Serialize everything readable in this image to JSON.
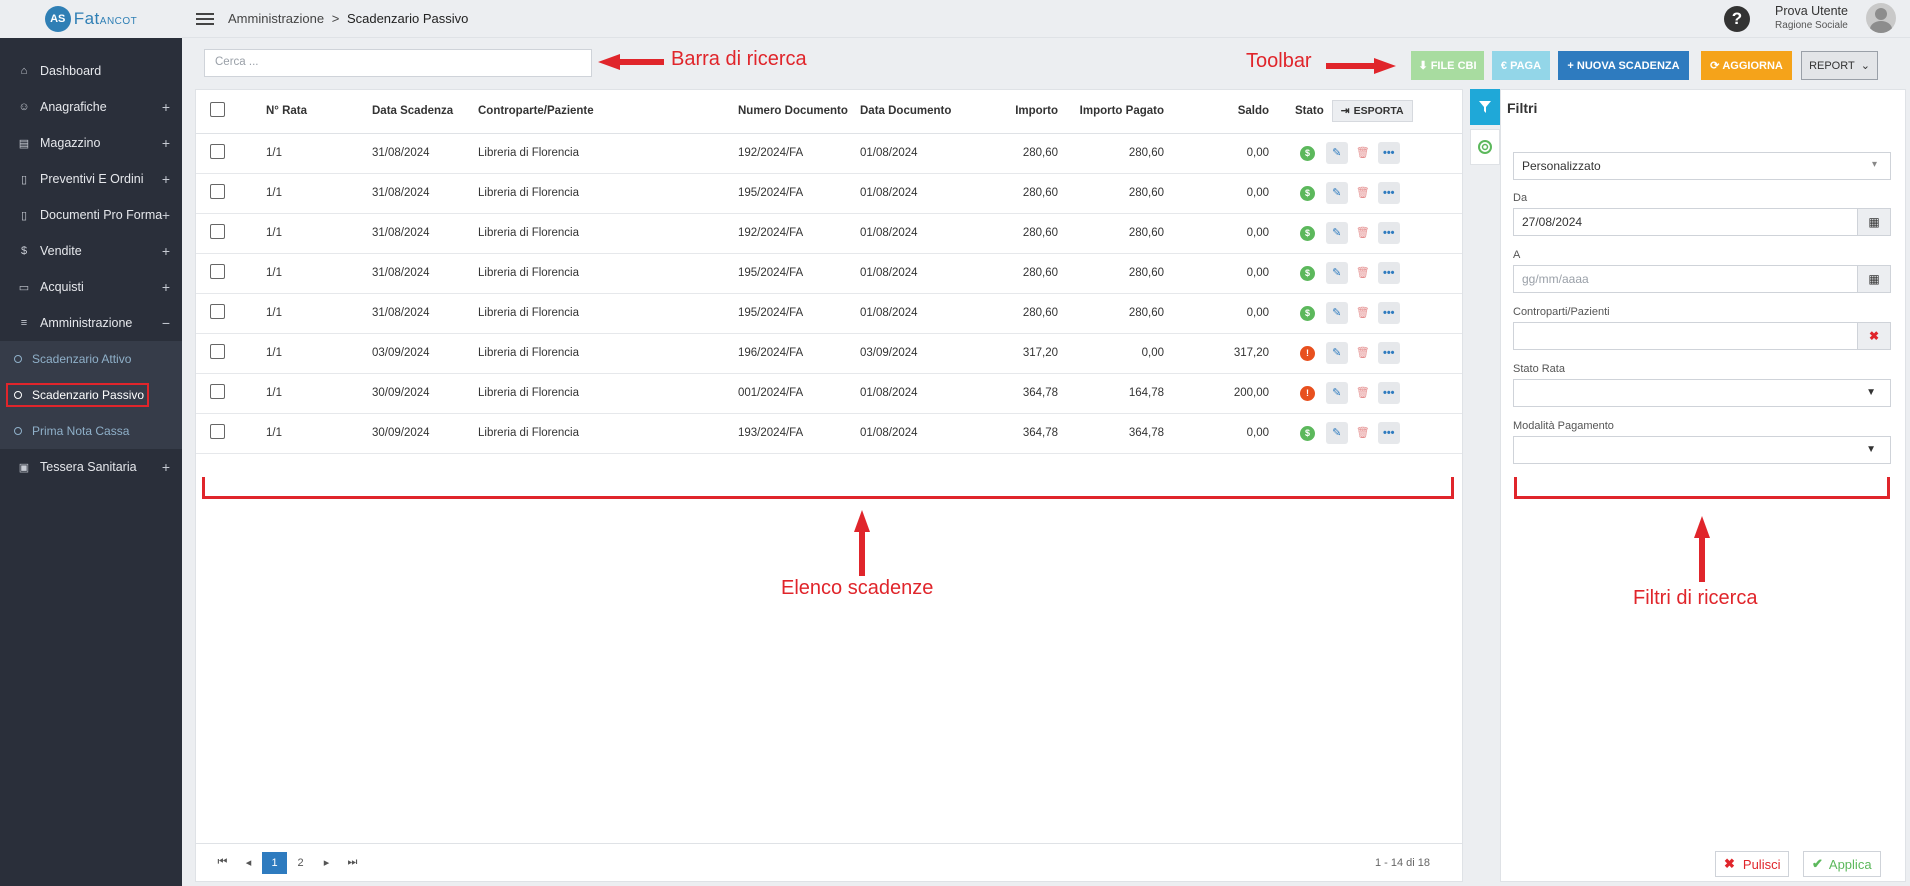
{
  "app": {
    "logo_badge": "AS",
    "logo_name": "Fat",
    "logo_suffix": "ANCOT"
  },
  "sidebar": {
    "items": [
      {
        "label": "Dashboard",
        "icon": "home-icon",
        "expandable": false
      },
      {
        "label": "Anagrafiche",
        "icon": "user-icon",
        "expandable": true
      },
      {
        "label": "Magazzino",
        "icon": "warehouse-icon",
        "expandable": true
      },
      {
        "label": "Preventivi E Ordini",
        "icon": "document-icon",
        "expandable": true
      },
      {
        "label": "Documenti Pro Forma",
        "icon": "document-icon",
        "expandable": true
      },
      {
        "label": "Vendite",
        "icon": "dollar-icon",
        "expandable": true
      },
      {
        "label": "Acquisti",
        "icon": "card-icon",
        "expandable": true
      },
      {
        "label": "Amministrazione",
        "icon": "database-icon",
        "expandable": true,
        "open": true
      },
      {
        "label": "Tessera Sanitaria",
        "icon": "id-card-icon",
        "expandable": true
      }
    ],
    "sub_items": [
      {
        "label": "Scadenzario Attivo",
        "active": false
      },
      {
        "label": "Scadenzario Passivo",
        "active": true
      },
      {
        "label": "Prima Nota Cassa",
        "active": false
      }
    ],
    "plus": "+",
    "minus": "−"
  },
  "topbar": {
    "breadcrumb_parent": "Amministrazione",
    "breadcrumb_sep": ">",
    "breadcrumb_current": "Scadenzario Passivo",
    "help": "?",
    "user_name": "Prova Utente",
    "user_role": "Ragione Sociale"
  },
  "search": {
    "placeholder": "Cerca ..."
  },
  "toolbar": {
    "file_cbi": "FILE CBI",
    "paga": "€ PAGA",
    "nuova_scadenza": "+ NUOVA SCADENZA",
    "aggiorna": "AGGIORNA",
    "report": "REPORT"
  },
  "annotations": {
    "search": "Barra di ricerca",
    "toolbar": "Toolbar",
    "list": "Elenco scadenze",
    "filters": "Filtri di ricerca"
  },
  "table": {
    "headers": {
      "rata": "N° Rata",
      "data_scadenza": "Data Scadenza",
      "controparte": "Controparte/Paziente",
      "numero_documento": "Numero Documento",
      "data_documento": "Data Documento",
      "importo": "Importo",
      "importo_pagato": "Importo Pagato",
      "saldo": "Saldo",
      "stato": "Stato",
      "esporta": "ESPORTA"
    },
    "rows": [
      {
        "rata": "1/1",
        "data_scadenza": "31/08/2024",
        "controparte": "Libreria di Florencia",
        "numero": "192/2024/FA",
        "data_documento": "01/08/2024",
        "importo": "280,60",
        "pagato": "280,60",
        "saldo": "0,00",
        "stato": "paid"
      },
      {
        "rata": "1/1",
        "data_scadenza": "31/08/2024",
        "controparte": "Libreria di Florencia",
        "numero": "195/2024/FA",
        "data_documento": "01/08/2024",
        "importo": "280,60",
        "pagato": "280,60",
        "saldo": "0,00",
        "stato": "paid"
      },
      {
        "rata": "1/1",
        "data_scadenza": "31/08/2024",
        "controparte": "Libreria di Florencia",
        "numero": "192/2024/FA",
        "data_documento": "01/08/2024",
        "importo": "280,60",
        "pagato": "280,60",
        "saldo": "0,00",
        "stato": "paid"
      },
      {
        "rata": "1/1",
        "data_scadenza": "31/08/2024",
        "controparte": "Libreria di Florencia",
        "numero": "195/2024/FA",
        "data_documento": "01/08/2024",
        "importo": "280,60",
        "pagato": "280,60",
        "saldo": "0,00",
        "stato": "paid"
      },
      {
        "rata": "1/1",
        "data_scadenza": "31/08/2024",
        "controparte": "Libreria di Florencia",
        "numero": "195/2024/FA",
        "data_documento": "01/08/2024",
        "importo": "280,60",
        "pagato": "280,60",
        "saldo": "0,00",
        "stato": "paid"
      },
      {
        "rata": "1/1",
        "data_scadenza": "03/09/2024",
        "controparte": "Libreria di Florencia",
        "numero": "196/2024/FA",
        "data_documento": "03/09/2024",
        "importo": "317,20",
        "pagato": "0,00",
        "saldo": "317,20",
        "stato": "warning"
      },
      {
        "rata": "1/1",
        "data_scadenza": "30/09/2024",
        "controparte": "Libreria di Florencia",
        "numero": "001/2024/FA",
        "data_documento": "01/08/2024",
        "importo": "364,78",
        "pagato": "164,78",
        "saldo": "200,00",
        "stato": "warning"
      },
      {
        "rata": "1/1",
        "data_scadenza": "30/09/2024",
        "controparte": "Libreria di Florencia",
        "numero": "193/2024/FA",
        "data_documento": "01/08/2024",
        "importo": "364,78",
        "pagato": "364,78",
        "saldo": "0,00",
        "stato": "paid"
      }
    ]
  },
  "pager": {
    "pages": [
      "1",
      "2"
    ],
    "current": "1",
    "info": "1 - 14 di 18"
  },
  "filters": {
    "title": "Filtri",
    "period": "Personalizzato",
    "da_label": "Da",
    "da_value": "27/08/2024",
    "a_label": "A",
    "a_placeholder": "gg/mm/aaaa",
    "controparti_label": "Controparti/Pazienti",
    "stato_label": "Stato Rata",
    "modalita_label": "Modalità Pagamento",
    "pulisci": "Pulisci",
    "applica": "Applica"
  },
  "colors": {
    "accent": "#2e7bbf",
    "annotation": "#e0252b",
    "sidebar": "#2a2f3a"
  }
}
